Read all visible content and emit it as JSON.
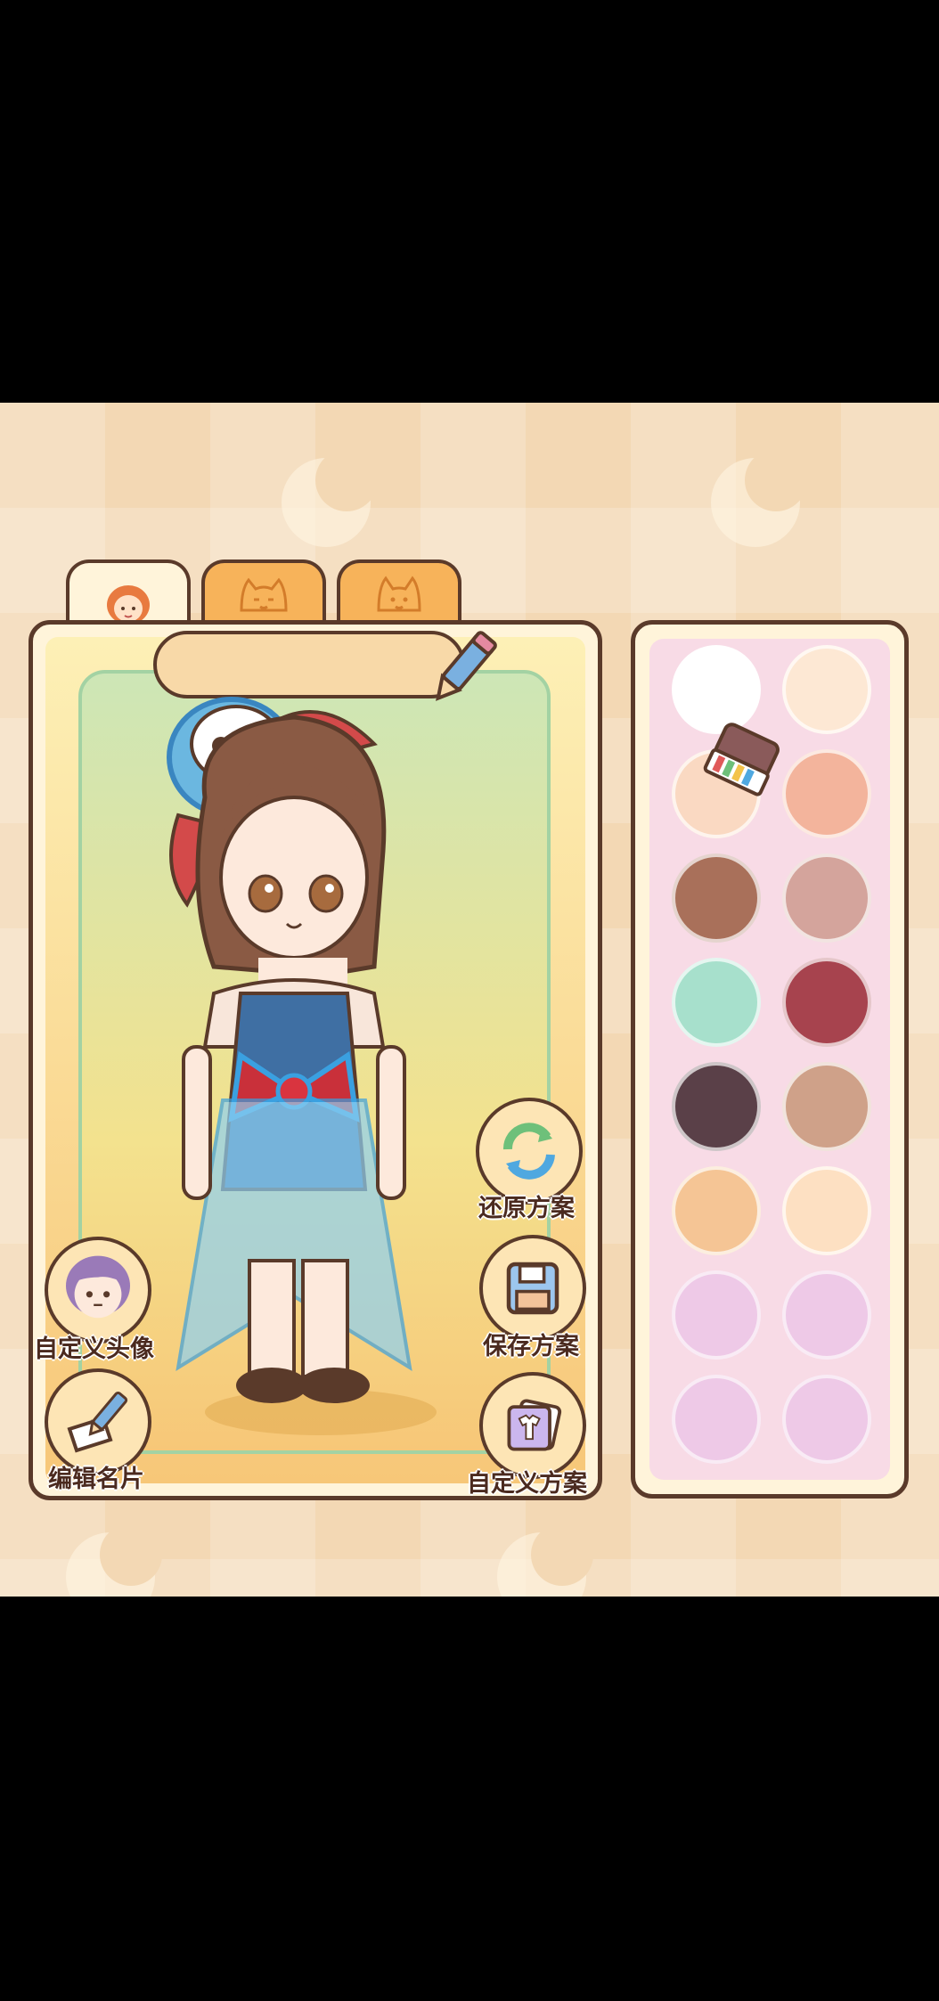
{
  "tabs": [
    {
      "name": "tab-character",
      "icon": "girl-face-icon",
      "active": true
    },
    {
      "name": "tab-pet-1",
      "icon": "cat-face-icon",
      "active": false
    },
    {
      "name": "tab-pet-2",
      "icon": "cat-face-icon",
      "active": false
    }
  ],
  "name_field": {
    "value": ""
  },
  "buttons": {
    "restore": "还原方案",
    "save": "保存方案",
    "custom_scheme": "自定义方案",
    "custom_avatar": "自定义头像",
    "edit_card": "编辑名片"
  },
  "palette": {
    "colors": [
      "#ffffff",
      "#fde8d4",
      "#fad9c2",
      "#f3b49c",
      "#a9705a",
      "#d4a49c",
      "#a7e0cc",
      "#a7434e",
      "#5a4048",
      "#cfa189",
      "#f5c595",
      "#fde0c2",
      "#edc7e8",
      "#edc7e8",
      "#edc7e8",
      "#edc7e8"
    ]
  },
  "theme": {
    "outline": "#5a3a2a",
    "tab_orange": "#f7b35a",
    "panel_cream": "#fff4da",
    "palette_bg": "#f8dbe6"
  }
}
